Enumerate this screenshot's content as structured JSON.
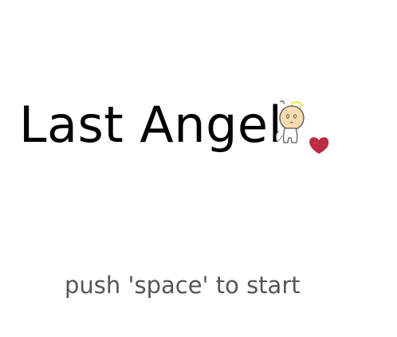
{
  "game": {
    "title": "Last Angel",
    "prompt": "push 'space' to start"
  },
  "sprites": {
    "angel": "angel-character-icon",
    "heart": "heart-icon"
  },
  "colors": {
    "background": "#ffffff",
    "title": "#000000",
    "prompt": "#555555",
    "halo": "#f2e34a",
    "skin": "#f6dcb0",
    "heart": "#b5142c"
  }
}
